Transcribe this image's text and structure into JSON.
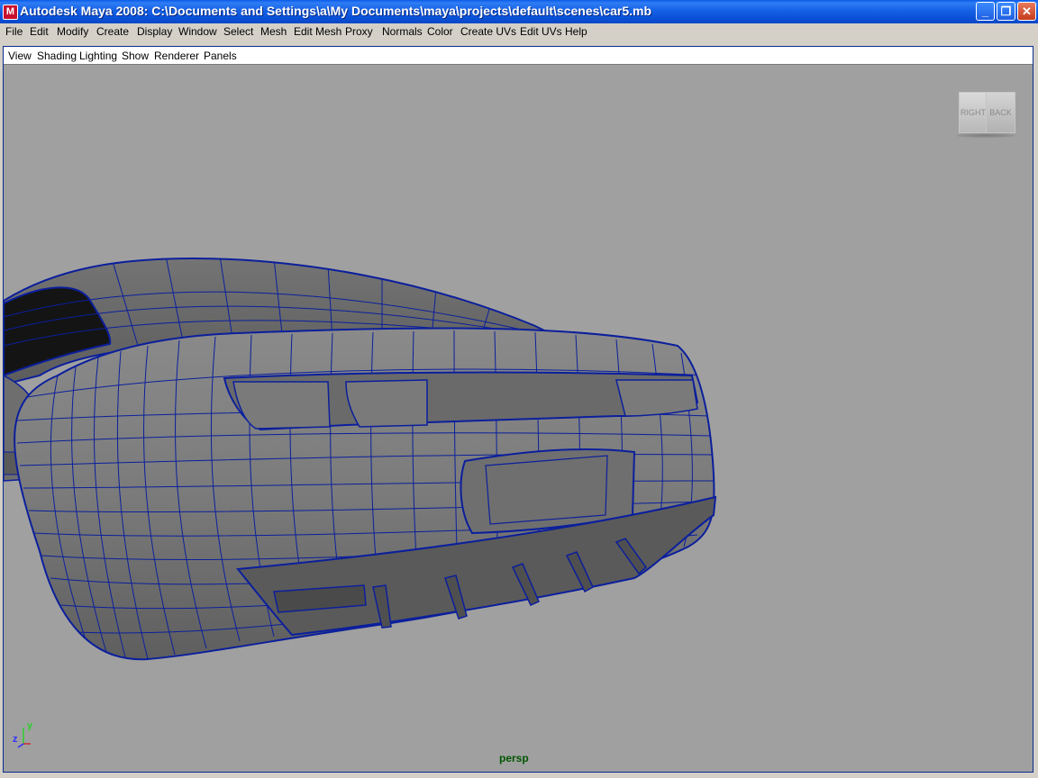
{
  "window": {
    "title": "Autodesk Maya 2008: C:\\Documents and Settings\\a\\My Documents\\maya\\projects\\default\\scenes\\car5.mb",
    "icon": "maya-app-icon",
    "min_symbol": "_",
    "max_symbol": "❐",
    "close_symbol": "✕"
  },
  "main_menu": [
    "File",
    "Edit",
    "Modify",
    "Create",
    "Display",
    "Window",
    "Select",
    "Mesh",
    "Edit Mesh",
    "Proxy",
    "Normals",
    "Color",
    "Create UVs",
    "Edit UVs",
    "Help"
  ],
  "panel_menu": [
    "View",
    "Shading",
    "Lighting",
    "Show",
    "Renderer",
    "Panels"
  ],
  "viewcube": {
    "right_label": "RIGHT",
    "back_label": "BACK"
  },
  "axis": {
    "y_label": "y",
    "z_label": "z"
  },
  "camera_label": "persp",
  "colors": {
    "viewport_bg": "#a0a0a0",
    "wireframe": "#0b1f9c",
    "title_bar": "#0a4fd6",
    "menu_bg": "#d4d0c8"
  }
}
